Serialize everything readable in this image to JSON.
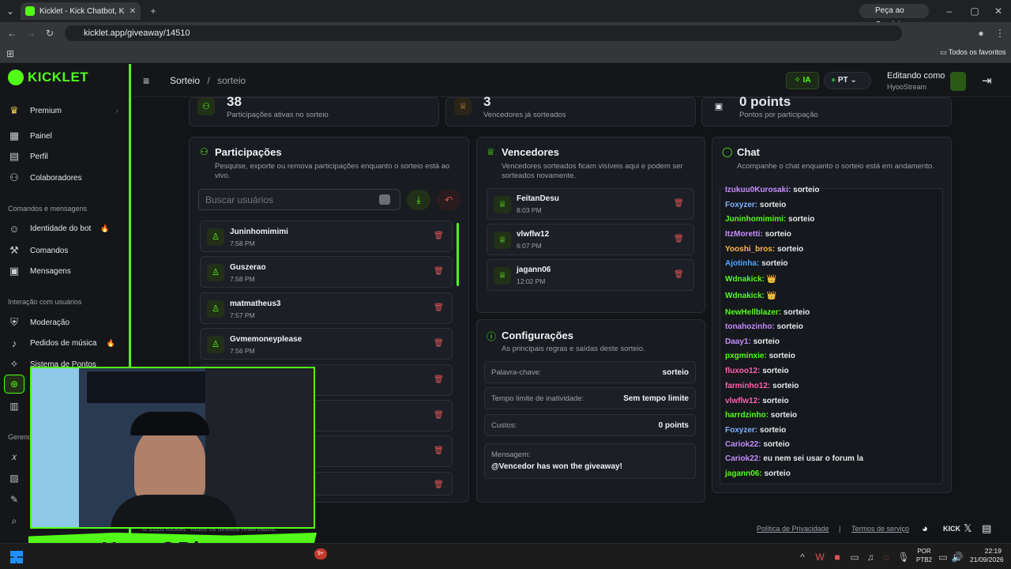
{
  "browser": {
    "tab_title": "Kicklet - Kick Chatbot, Kick Wi",
    "url": "kicklet.app/giveaway/14510",
    "gemini_label": "Peça ao Gemini",
    "favorites_label": "Todos os favoritos"
  },
  "app": {
    "logo": "KICKLET",
    "breadcrumb_parent": "Sorteio",
    "breadcrumb_sep": "/",
    "breadcrumb_current": "sorteio",
    "ai_label": "IA",
    "lang_label": "PT",
    "editing_label": "Editando como",
    "editing_user": "HyooStream"
  },
  "sidebar": {
    "premium": "Premium",
    "items_top": [
      "Painel",
      "Perfil",
      "Colaboradores"
    ],
    "section1": "Comandos e mensagens",
    "items_cmd": [
      "Identidade do bot",
      "Comandos",
      "Mensagens"
    ],
    "section2": "Interação com usuários",
    "items_int": [
      "Moderação",
      "Pedidos de música",
      "Sistema de Pontos"
    ],
    "section3": "Gerenc"
  },
  "stats": [
    {
      "value": "38",
      "label": "Participações ativas no sorteio"
    },
    {
      "value": "3",
      "label": "Vencedores já sorteados"
    },
    {
      "value": "0 points",
      "label": "Pontos por participação"
    }
  ],
  "participants": {
    "title": "Participações",
    "subtitle": "Pesquise, exporte ou remova participações enquanto o sorteio está ao vivo.",
    "search_placeholder": "Buscar usuários",
    "rows": [
      {
        "name": "Juninhomimimi",
        "time": "7:58 PM"
      },
      {
        "name": "Guszerao",
        "time": "7:58 PM"
      },
      {
        "name": "matmatheus3",
        "time": "7:57 PM"
      },
      {
        "name": "Gvmemoneyplease",
        "time": "7:56 PM"
      }
    ]
  },
  "winners": {
    "title": "Vencedores",
    "subtitle": "Vencedores sorteados ficam visíveis aqui e podem ser sorteados novamente.",
    "rows": [
      {
        "name": "FeitanDesu",
        "time": "8:03 PM"
      },
      {
        "name": "vlwflw12",
        "time": "6:07 PM"
      },
      {
        "name": "jagann06",
        "time": "12:02 PM"
      }
    ]
  },
  "config": {
    "title": "Configurações",
    "subtitle": "As principais regras e saídas deste sorteio.",
    "keyword_label": "Palavra-chave:",
    "keyword_value": "sorteio",
    "timeout_label": "Tempo limite de inatividade:",
    "timeout_value": "Sem tempo limite",
    "cost_label": "Custos:",
    "cost_value": "0 points",
    "message_label": "Mensagem:",
    "message_value": "@Vencedor has won the giveaway!"
  },
  "chat": {
    "title": "Chat",
    "subtitle": "Acompanhe o chat enquanto o sorteio está em andamento.",
    "lines": [
      {
        "user": "Izukuu0Kurosaki:",
        "msg": "sorteio",
        "color": "#c58cff"
      },
      {
        "user": "Foxyzer:",
        "msg": "sorteio",
        "color": "#7fb2ff"
      },
      {
        "user": "Juninhomimimi:",
        "msg": "sorteio",
        "color": "#53fc18"
      },
      {
        "user": "ItzMoretti:",
        "msg": "sorteio",
        "color": "#c58cff"
      },
      {
        "user": "Yooshi_bros:",
        "msg": "sorteio",
        "color": "#ffb84d"
      },
      {
        "user": "Ajotinha:",
        "msg": "sorteio",
        "color": "#4da6ff"
      },
      {
        "user": "Wdnakick:",
        "msg": "👑",
        "color": "#53fc18"
      },
      {
        "user": "Wdnakick:",
        "msg": "👑",
        "color": "#53fc18"
      },
      {
        "user": "NewHellblazer:",
        "msg": "sorteio",
        "color": "#53fc18"
      },
      {
        "user": "tonahozinho:",
        "msg": "sorteio",
        "color": "#c58cff"
      },
      {
        "user": "Daay1:",
        "msg": "sorteio",
        "color": "#c58cff"
      },
      {
        "user": "pxgminxie:",
        "msg": "sorteio",
        "color": "#53fc18"
      },
      {
        "user": "fluxoo12:",
        "msg": "sorteio",
        "color": "#ff5fb0"
      },
      {
        "user": "farminho12:",
        "msg": "sorteio",
        "color": "#ff5fb0"
      },
      {
        "user": "vlwflw12:",
        "msg": "sorteio",
        "color": "#ff5fb0"
      },
      {
        "user": "harrdzinho:",
        "msg": "sorteio",
        "color": "#53fc18"
      },
      {
        "user": "Foxyzer:",
        "msg": "sorteio",
        "color": "#7fb2ff"
      },
      {
        "user": "Cariok22:",
        "msg": "sorteio",
        "color": "#c58cff"
      },
      {
        "user": "Cariok22:",
        "msg": "eu nem sei usar o forum la",
        "color": "#c58cff"
      },
      {
        "user": "jagann06:",
        "msg": "sorteio",
        "color": "#53fc18"
      }
    ]
  },
  "footer": {
    "copyright": "© 2026 Kicklet. Todos os direitos reservados.",
    "privacy": "Política de Privacidade",
    "sep": "|",
    "terms": "Termos de serviço",
    "kick_label": "KICK"
  },
  "overlay": {
    "banner_text": "HyooGPlays",
    "badge": "9+"
  },
  "taskbar": {
    "lang": "POR",
    "layout": "PTB2",
    "time": "22:19",
    "date": "21/09/2026"
  },
  "colors": {
    "accent": "#53fc18",
    "danger": "#e05555",
    "panel": "#181b20"
  }
}
